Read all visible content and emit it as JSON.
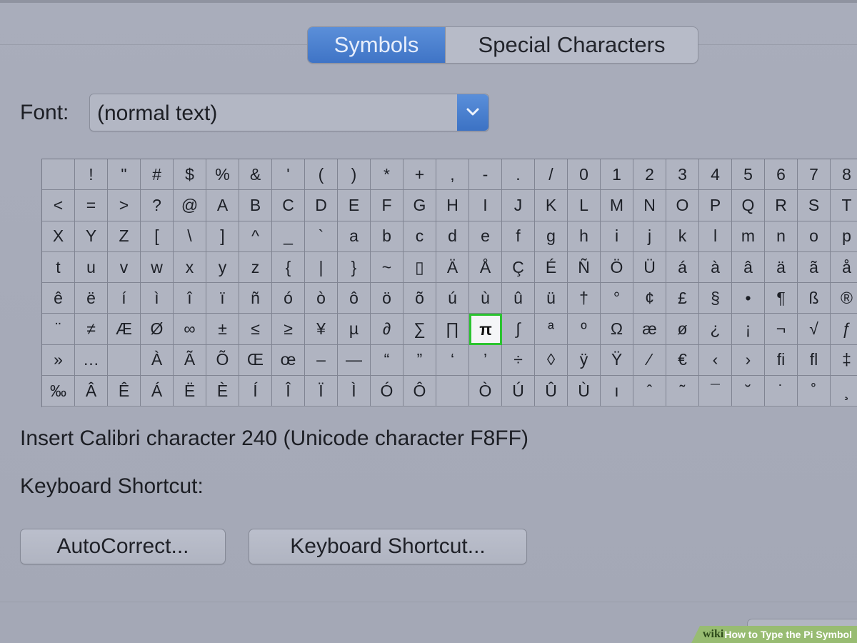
{
  "tabs": {
    "active": "Symbols",
    "inactive": "Special Characters"
  },
  "font": {
    "label": "Font:",
    "value": "(normal text)"
  },
  "symbol_grid": {
    "rows": [
      [
        " ",
        "!",
        "\"",
        "#",
        "$",
        "%",
        "&",
        "'",
        "(",
        ")",
        "*",
        "+",
        ",",
        "-",
        ".",
        "/",
        "0",
        "1",
        "2",
        "3",
        "4",
        "5",
        "6",
        "7",
        "8"
      ],
      [
        "<",
        "=",
        ">",
        "?",
        "@",
        "A",
        "B",
        "C",
        "D",
        "E",
        "F",
        "G",
        "H",
        "I",
        "J",
        "K",
        "L",
        "M",
        "N",
        "O",
        "P",
        "Q",
        "R",
        "S",
        "T"
      ],
      [
        "X",
        "Y",
        "Z",
        "[",
        "\\",
        "]",
        "^",
        "_",
        "`",
        "a",
        "b",
        "c",
        "d",
        "e",
        "f",
        "g",
        "h",
        "i",
        "j",
        "k",
        "l",
        "m",
        "n",
        "o",
        "p"
      ],
      [
        "t",
        "u",
        "v",
        "w",
        "x",
        "y",
        "z",
        "{",
        "|",
        "}",
        "~",
        "▯",
        "Ä",
        "Å",
        "Ç",
        "É",
        "Ñ",
        "Ö",
        "Ü",
        "á",
        "à",
        "â",
        "ä",
        "ã",
        "å"
      ],
      [
        "ê",
        "ë",
        "í",
        "ì",
        "î",
        "ï",
        "ñ",
        "ó",
        "ò",
        "ô",
        "ö",
        "õ",
        "ú",
        "ù",
        "û",
        "ü",
        "†",
        "°",
        "¢",
        "£",
        "§",
        "•",
        "¶",
        "ß",
        "®"
      ],
      [
        "¨",
        "≠",
        "Æ",
        "Ø",
        "∞",
        "±",
        "≤",
        "≥",
        "¥",
        "µ",
        "∂",
        "∑",
        "∏",
        "π",
        "∫",
        "ª",
        "º",
        "Ω",
        "æ",
        "ø",
        "¿",
        "¡",
        "¬",
        "√",
        "ƒ"
      ],
      [
        "»",
        "…",
        " ",
        "À",
        "Ã",
        "Õ",
        "Œ",
        "œ",
        "–",
        "—",
        "“",
        "”",
        "‘",
        "’",
        "÷",
        "◊",
        "ÿ",
        "Ÿ",
        "⁄",
        "€",
        "‹",
        "›",
        "ﬁ",
        "ﬂ",
        "‡"
      ],
      [
        "‰",
        "Â",
        "Ê",
        "Á",
        "Ë",
        "È",
        "Í",
        "Î",
        "Ï",
        "Ì",
        "Ó",
        "Ô",
        "",
        "Ò",
        "Ú",
        "Û",
        "Ù",
        "ı",
        "ˆ",
        "˜",
        "¯",
        "˘",
        "˙",
        "˚",
        "¸"
      ]
    ],
    "selected": {
      "row": 5,
      "col": 13
    }
  },
  "insert_info": "Insert Calibri character 240  (Unicode character F8FF)",
  "keyboard_shortcut_label": "Keyboard Shortcut:",
  "buttons": {
    "autocorrect": "AutoCorrect...",
    "keyboard_shortcut": "Keyboard Shortcut..."
  },
  "watermark": {
    "logo": "wiki",
    "title": "How to Type the Pi Symbol"
  },
  "icons": {
    "select_arrow": "chevron-down-icon",
    "apple_logo": "apple-logo-icon"
  },
  "colors": {
    "accent": "#4a80d0",
    "selection": "#2bc430",
    "background": "#a7abb9"
  }
}
